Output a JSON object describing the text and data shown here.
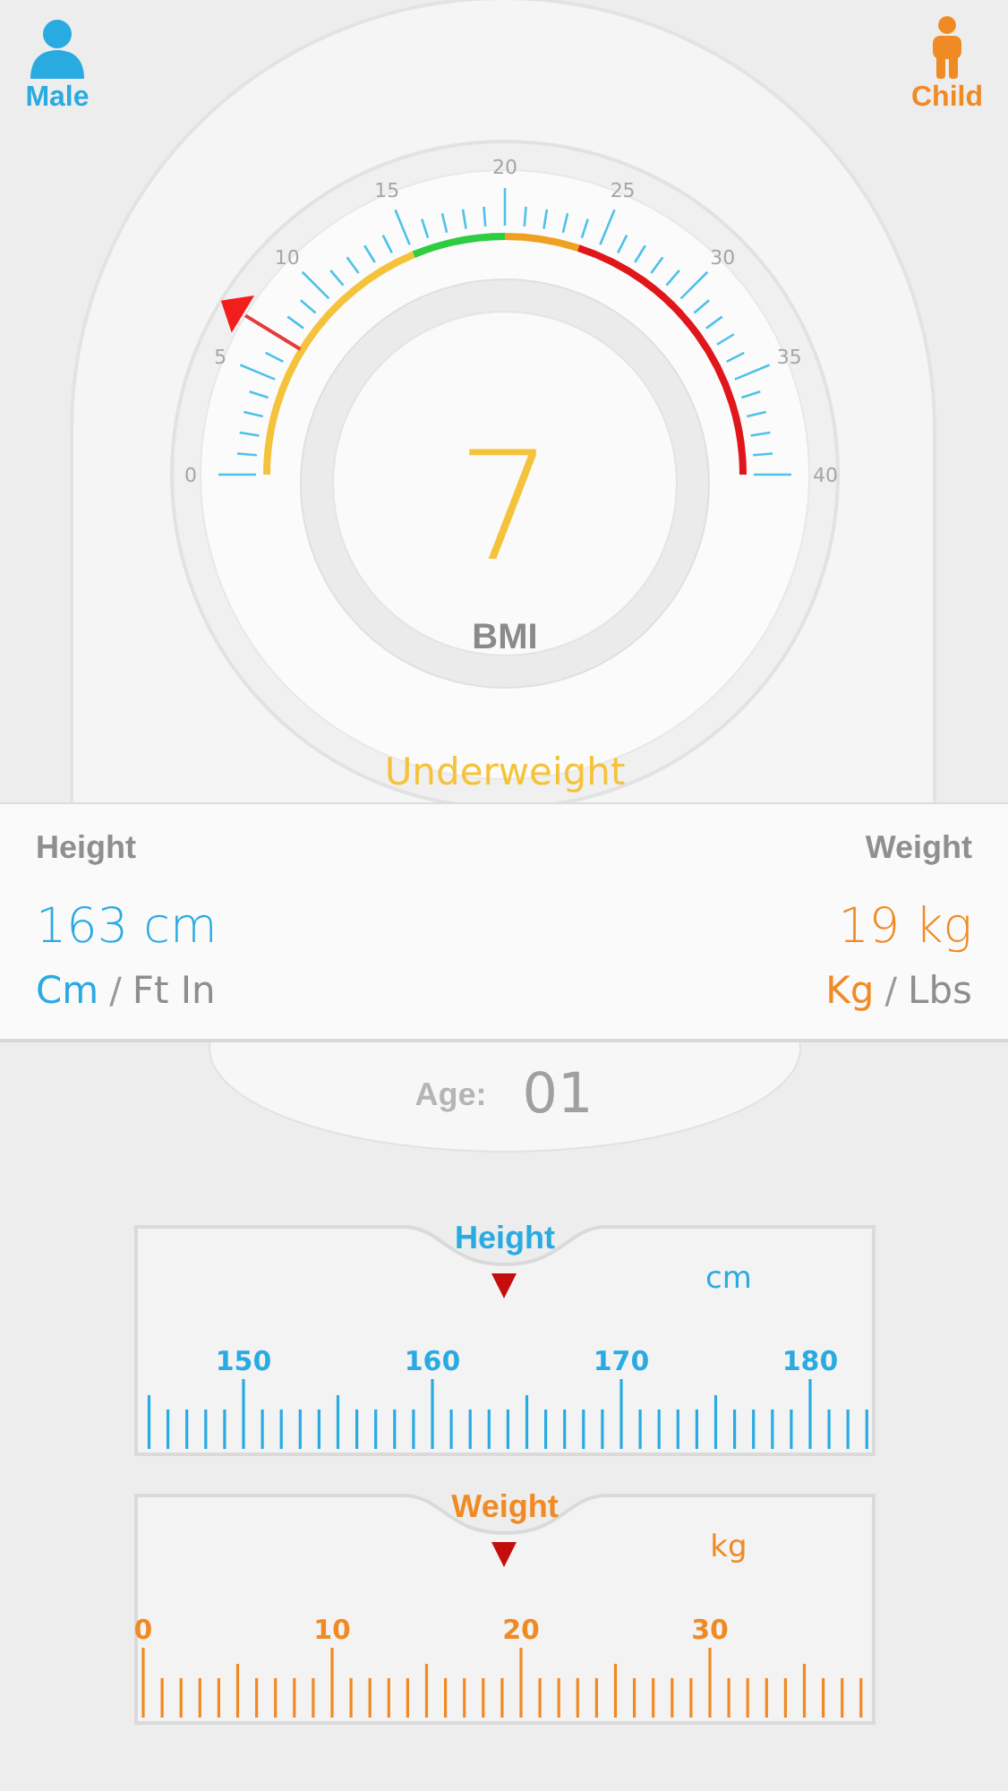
{
  "header": {
    "gender": {
      "label": "Male"
    },
    "group": {
      "label": "Child"
    }
  },
  "gauge": {
    "scale_labels": [
      "0",
      "5",
      "10",
      "15",
      "20",
      "25",
      "30",
      "35",
      "40"
    ],
    "zones": [
      {
        "color": "#f5c33b"
      },
      {
        "color": "#2ecc40"
      },
      {
        "color": "#f0a020"
      },
      {
        "color": "#e0161b"
      }
    ],
    "level": 0.175,
    "value": "7",
    "unit": "BMI",
    "status": "Underweight"
  },
  "measures": [
    {
      "label": "Height",
      "value": "163 cm",
      "color": "#29abe2",
      "separator": "/",
      "units": [
        {
          "label": "Cm",
          "selected": true
        },
        {
          "label": "Ft In",
          "selected": false
        }
      ]
    },
    {
      "label": "Weight",
      "value": "19 kg",
      "color": "#f08a24",
      "separator": "/",
      "units": [
        {
          "label": "Kg",
          "selected": true
        },
        {
          "label": "Lbs",
          "selected": false
        }
      ]
    }
  ],
  "age": {
    "label": "Age:",
    "value": "01"
  },
  "rulers": [
    {
      "title": "Height",
      "unit": "cm",
      "color": "#29abe2",
      "labels": [
        "150",
        "160",
        "170",
        "180"
      ],
      "level": 0.5
    },
    {
      "title": "Weight",
      "unit": "kg",
      "color": "#f08a24",
      "labels": [
        "0",
        "10",
        "20",
        "30"
      ],
      "level": 0.5
    }
  ]
}
